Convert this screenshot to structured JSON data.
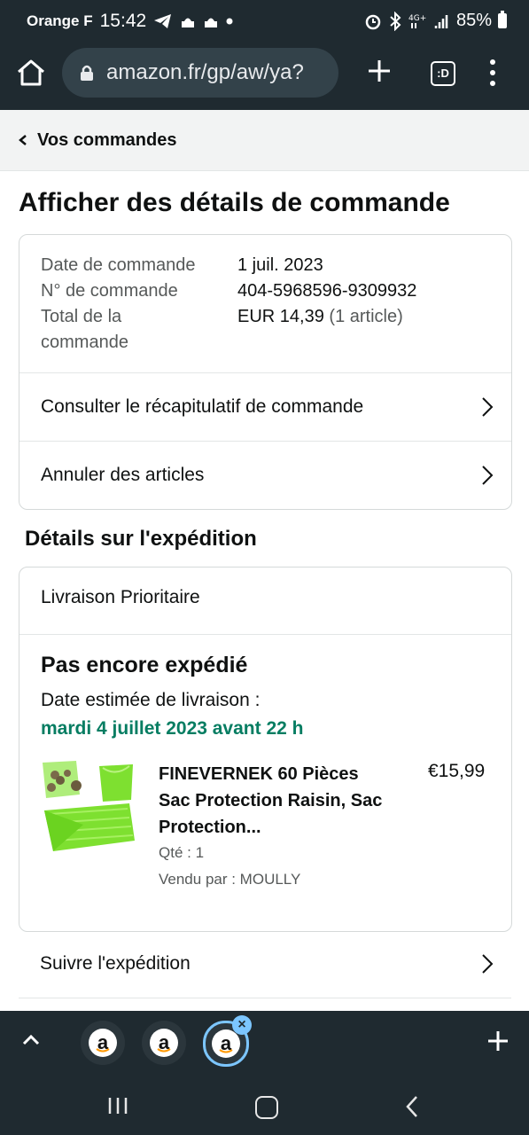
{
  "status_bar": {
    "carrier": "Orange F",
    "time": "15:42",
    "battery": "85%"
  },
  "browser": {
    "url": "amazon.fr/gp/aw/ya?",
    "tabs_label": ":D"
  },
  "breadcrumb": {
    "label": "Vos commandes"
  },
  "page_title": "Afficher des détails de commande",
  "order_summary": {
    "date_label": "Date de commande",
    "date_value": "1 juil. 2023",
    "number_label": "N° de commande",
    "number_value": "404-5968596-9309932",
    "total_label_line1": "Total de la",
    "total_label_line2": "commande",
    "total_value": "EUR 14,39",
    "total_items": "(1 article)"
  },
  "order_links": [
    {
      "label": "Consulter le récapitulatif de commande"
    },
    {
      "label": "Annuler des articles"
    }
  ],
  "shipping": {
    "section_title": "Détails sur l'expédition",
    "method": "Livraison Prioritaire",
    "status": "Pas encore expédié",
    "estimate_label": "Date estimée de livraison :",
    "estimate_date": "mardi 4 juillet 2023 avant 22 h",
    "product": {
      "title": "FINEVERNEK 60 Pièces Sac Protection Raisin, Sac Protection...",
      "price": "€15,99",
      "quantity": "Qté : 1",
      "seller": "Vendu par : MOULLY"
    },
    "track_label": "Suivre l'expédition"
  },
  "tab_strip": {
    "tab_letter": "a",
    "close_label": "×"
  },
  "colors": {
    "chrome_dark": "#1f2a30",
    "delivery_green": "#067d62",
    "active_tab_ring": "#7cc6ff",
    "product_green": "#7ee030"
  }
}
